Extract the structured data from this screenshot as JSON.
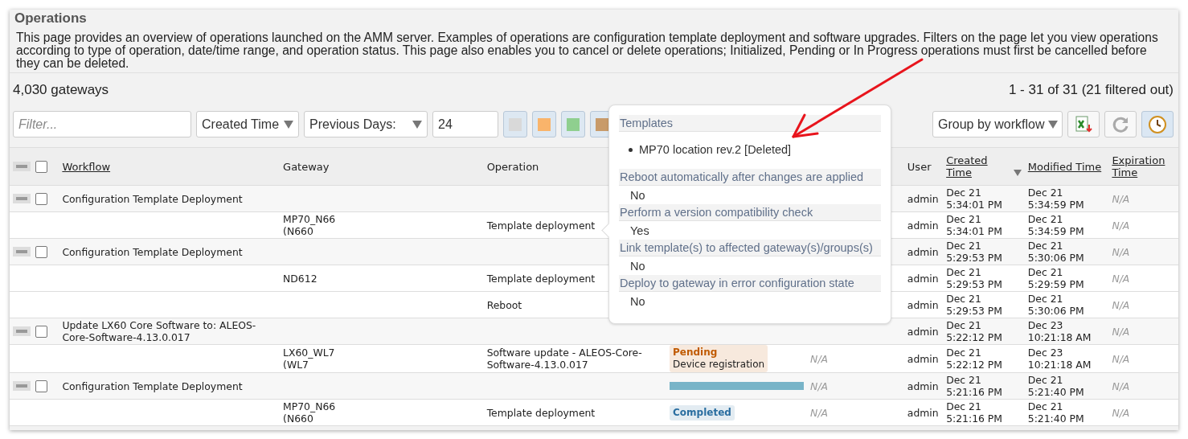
{
  "page": {
    "title": "Operations",
    "description": "This page provides an overview of operations launched on the AMM server. Examples of operations are configuration template deployment and software upgrades. Filters on the page let you view operations according to type of operation, date/time range, and operation status. This page also enables you to cancel or delete operations; Initialized, Pending or In Progress operations must first be cancelled before they can be deleted."
  },
  "summary": {
    "count": "4,030 gateways",
    "range": "1 - 31 of 31 (21 filtered out)"
  },
  "toolbar": {
    "filter": {
      "placeholder": "Filter..."
    },
    "time_field": "Created Time",
    "period": "Previous Days:",
    "days": "24",
    "status_filters": [
      {
        "color": "#d9d9d9"
      },
      {
        "color": "#f9b46b"
      },
      {
        "color": "#8fcf8f"
      },
      {
        "color": "#c89b6a"
      }
    ],
    "group_by": "Group by workflow",
    "auto_refresh": {
      "selected": true
    }
  },
  "table": {
    "select_all": {
      "checked": false
    },
    "columns": [
      {
        "label": "Workflow",
        "sortable": true
      },
      {
        "label": "Gateway",
        "sortable": false
      },
      {
        "label": "Operation",
        "sortable": false
      },
      {
        "label": "User",
        "sortable": false
      },
      {
        "label": "Created Time",
        "sortable": true
      },
      {
        "label": "Modified Time",
        "sortable": true
      },
      {
        "label": "Expiration Time",
        "sortable": true
      }
    ],
    "rows": [
      {
        "kind": "group",
        "checked": false,
        "workflow": "Configuration Template Deployment",
        "user": "admin",
        "created": [
          "Dec 21",
          "5:34:01 PM"
        ],
        "modified": [
          "Dec 21",
          "5:34:59 PM"
        ],
        "expiration": "N/A"
      },
      {
        "kind": "item",
        "gateway": [
          "MP70_N66",
          "(N660"
        ],
        "operation": "Template deployment",
        "user": "admin",
        "created": [
          "Dec 21",
          "5:34:01 PM"
        ],
        "modified": [
          "Dec 21",
          "5:34:59 PM"
        ],
        "expiration": "N/A"
      },
      {
        "kind": "group",
        "checked": false,
        "workflow": "Configuration Template Deployment",
        "user": "admin",
        "created": [
          "Dec 21",
          "5:29:53 PM"
        ],
        "modified": [
          "Dec 21",
          "5:30:06 PM"
        ],
        "expiration": "N/A"
      },
      {
        "kind": "item",
        "gateway": [
          "ND612"
        ],
        "operation": "Template deployment",
        "user": "admin",
        "created": [
          "Dec 21",
          "5:29:53 PM"
        ],
        "modified": [
          "Dec 21",
          "5:29:59 PM"
        ],
        "expiration": "N/A"
      },
      {
        "kind": "item",
        "operation": "Reboot",
        "user": "admin",
        "created": [
          "Dec 21",
          "5:29:53 PM"
        ],
        "modified": [
          "Dec 21",
          "5:30:06 PM"
        ],
        "expiration": "N/A"
      },
      {
        "kind": "group",
        "checked": false,
        "workflow": "Update LX60 Core Software to: ALEOS-Core-Software-4.13.0.017",
        "user": "admin",
        "created": [
          "Dec 21",
          "5:22:12 PM"
        ],
        "modified": [
          "Dec 23",
          "10:21:18 AM"
        ],
        "expiration": "N/A"
      },
      {
        "kind": "item",
        "gateway": [
          "LX60_WL7",
          "(WL7"
        ],
        "operation": "Software update - ALEOS-Core-Software-4.13.0.017",
        "status": {
          "kind": "badge",
          "color": "#c05a00",
          "label": "Pending",
          "detail": "Device registration"
        },
        "progress": "N/A",
        "user": "admin",
        "created": [
          "Dec 21",
          "5:22:12 PM"
        ],
        "modified": [
          "Dec 23",
          "10:21:18 AM"
        ],
        "expiration": "N/A"
      },
      {
        "kind": "group",
        "checked": false,
        "workflow": "Configuration Template Deployment",
        "status": {
          "kind": "progress",
          "level": 1
        },
        "progress": "N/A",
        "user": "admin",
        "created": [
          "Dec 21",
          "5:21:16 PM"
        ],
        "modified": [
          "Dec 21",
          "5:21:40 PM"
        ],
        "expiration": "N/A"
      },
      {
        "kind": "item",
        "gateway": [
          "MP70_N66",
          "(N660"
        ],
        "operation": "Template deployment",
        "status": {
          "kind": "badge",
          "color": "#2a6ea0",
          "label": "Completed"
        },
        "progress": "N/A",
        "user": "admin",
        "created": [
          "Dec 21",
          "5:21:16 PM"
        ],
        "modified": [
          "Dec 21",
          "5:21:40 PM"
        ],
        "expiration": "N/A"
      }
    ]
  },
  "popover": {
    "sections": [
      {
        "heading": "Templates",
        "items": [
          "MP70 location rev.2 [Deleted]"
        ]
      },
      {
        "heading": "Reboot automatically after changes are applied",
        "value": "No"
      },
      {
        "heading": "Perform a version compatibility check",
        "value": "Yes"
      },
      {
        "heading": "Link template(s) to affected gateway(s)/groups(s)",
        "value": "No"
      },
      {
        "heading": "Deploy to gateway in error configuration state",
        "value": "No"
      }
    ]
  }
}
